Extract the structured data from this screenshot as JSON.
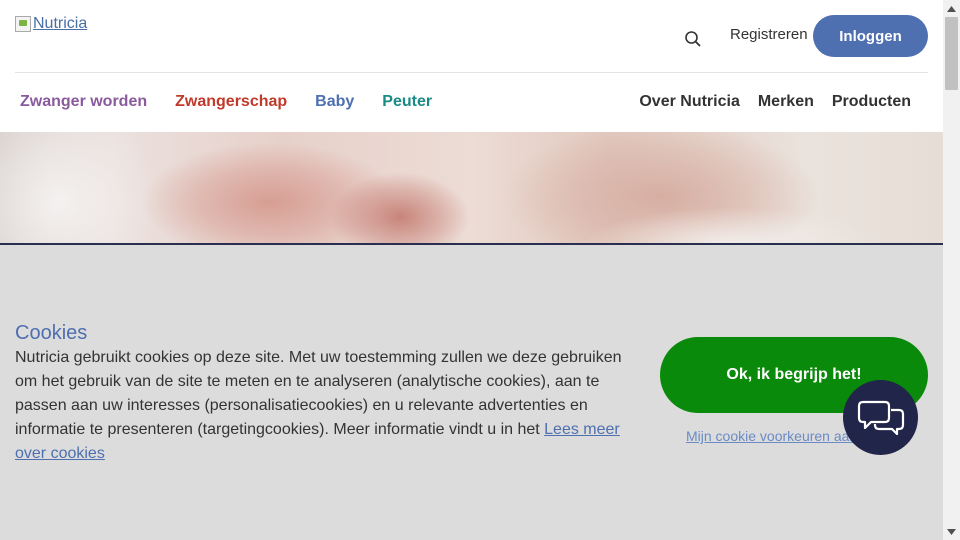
{
  "header": {
    "logo_alt": "Nutricia",
    "search_icon": "search-icon",
    "register_label": "Registreren",
    "login_label": "Inloggen"
  },
  "nav": {
    "left": [
      {
        "label": "Zwanger worden",
        "color": "#8a5a9e"
      },
      {
        "label": "Zwangerschap",
        "color": "#c0392b"
      },
      {
        "label": "Baby",
        "color": "#4e6fb0"
      },
      {
        "label": "Peuter",
        "color": "#1a8a86"
      }
    ],
    "right": [
      {
        "label": "Over Nutricia"
      },
      {
        "label": "Merken"
      },
      {
        "label": "Producten"
      }
    ]
  },
  "cookie": {
    "title": "Cookies",
    "text": "Nutricia gebruikt cookies op deze site. Met uw toestemming zullen we deze gebruiken om het gebruik van de site te meten en te analyseren (analytische cookies), aan te passen aan uw interesses (personalisatiecookies) en u relevante advertenties en informatie te presenteren (targetingcookies). Meer informatie vindt u in het ",
    "link_label": "Lees meer over cookies",
    "accept_label": "Ok, ik begrijp het!",
    "prefs_label": "Mijn cookie voorkeuren aanpassen"
  },
  "chat": {
    "icon": "chat-bubbles-icon"
  },
  "colors": {
    "brand_blue": "#4e6fb0",
    "accept_green": "#0a8a0a",
    "chat_navy": "#22254a",
    "overlay_grey": "#dcdcdc"
  }
}
